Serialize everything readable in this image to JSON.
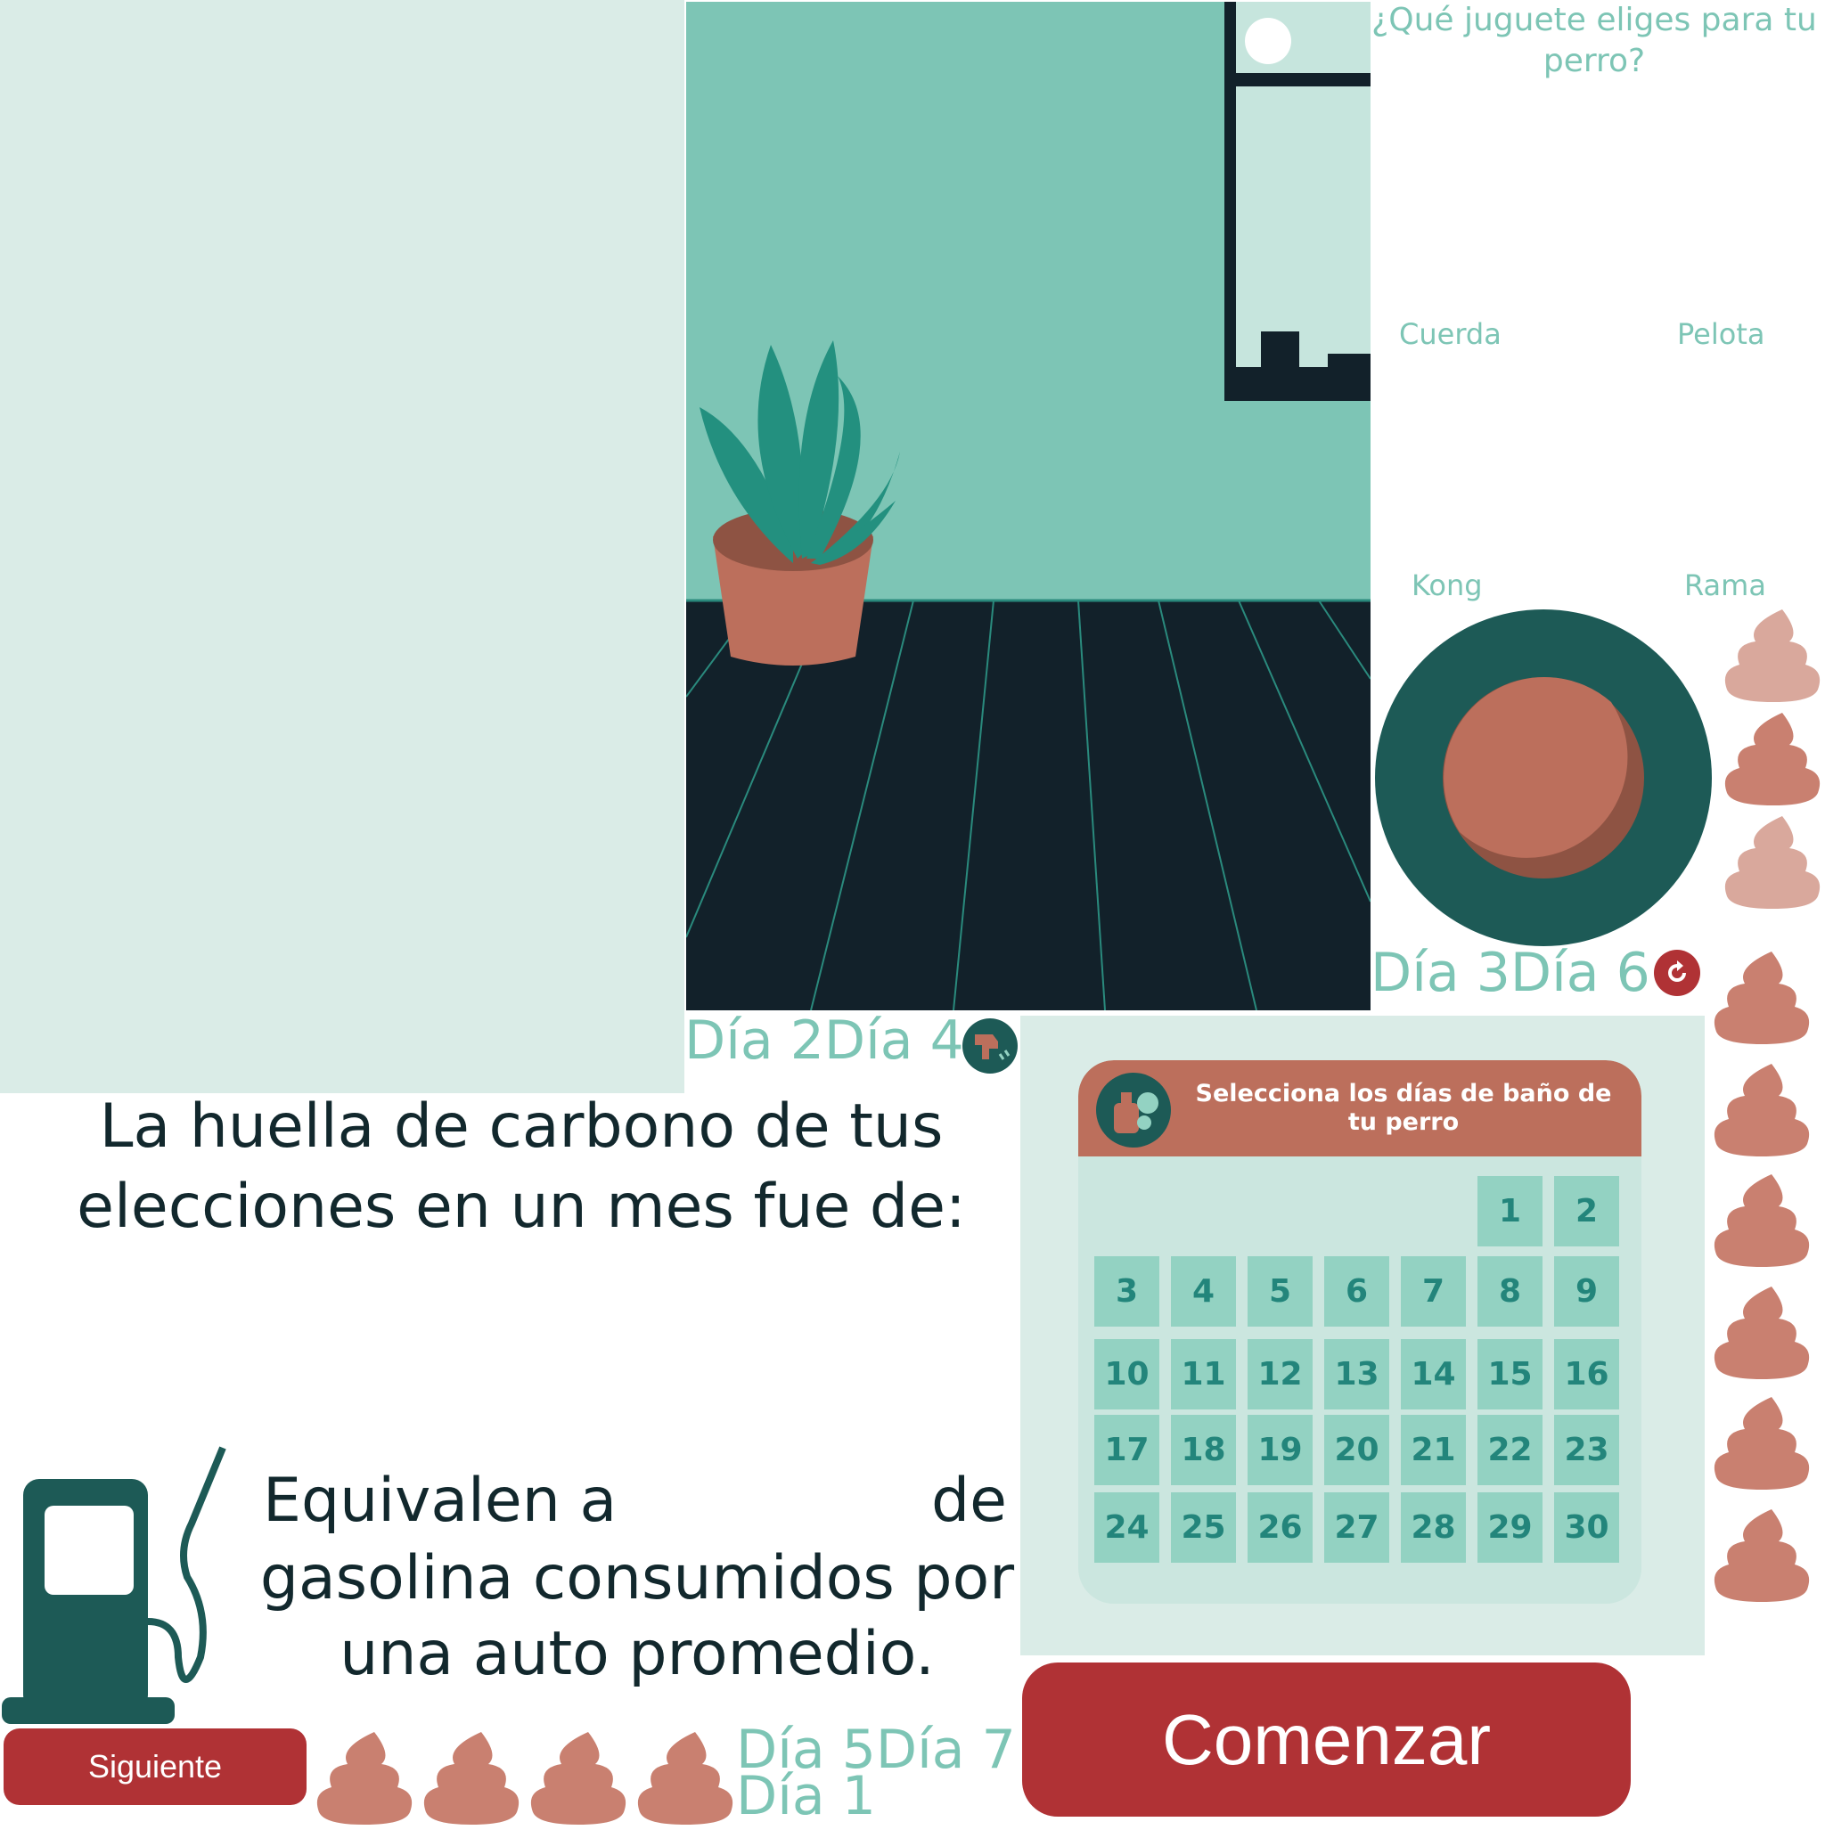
{
  "colors": {
    "mint_bg": "#daece7",
    "wall": "#7dc5b5",
    "floor": "#12212a",
    "dark_green": "#1d5a56",
    "terracotta": "#bc6f5c",
    "button_red": "#b03235",
    "label_teal": "#7dc5b5",
    "text_dark": "#12282d"
  },
  "toy_quiz": {
    "question": "¿Qué juguete eliges para tu perro?",
    "options": [
      "Cuerda",
      "Pelota",
      "Kong",
      "Rama"
    ]
  },
  "day_labels": {
    "a": "Día 3Día 6",
    "b": "Día 2Día 4",
    "c": "Día 5Día 7",
    "d": "Día 1"
  },
  "carbon": {
    "line1": "La huella de carbono de tus",
    "line2": "elecciones en un mes fue de:"
  },
  "equivalence": {
    "part1": "Equivalen a",
    "part2": "de",
    "line2": "gasolina consumidos por",
    "line3": "una auto promedio."
  },
  "calendar": {
    "title": "Selecciona los días de baño de tu perro",
    "days": [
      "1",
      "2",
      "3",
      "4",
      "5",
      "6",
      "7",
      "8",
      "9",
      "10",
      "11",
      "12",
      "13",
      "14",
      "15",
      "16",
      "17",
      "18",
      "19",
      "20",
      "21",
      "22",
      "23",
      "24",
      "25",
      "26",
      "27",
      "28",
      "29",
      "30"
    ]
  },
  "buttons": {
    "start": "Comenzar",
    "next": "Siguiente"
  },
  "icons": {
    "fuel": "gas-pump-icon",
    "reset": "reset-icon",
    "shower": "shower-icon",
    "shampoo": "shampoo-bottle-icon",
    "poop": "poop-icon",
    "ball": "ball-icon"
  }
}
